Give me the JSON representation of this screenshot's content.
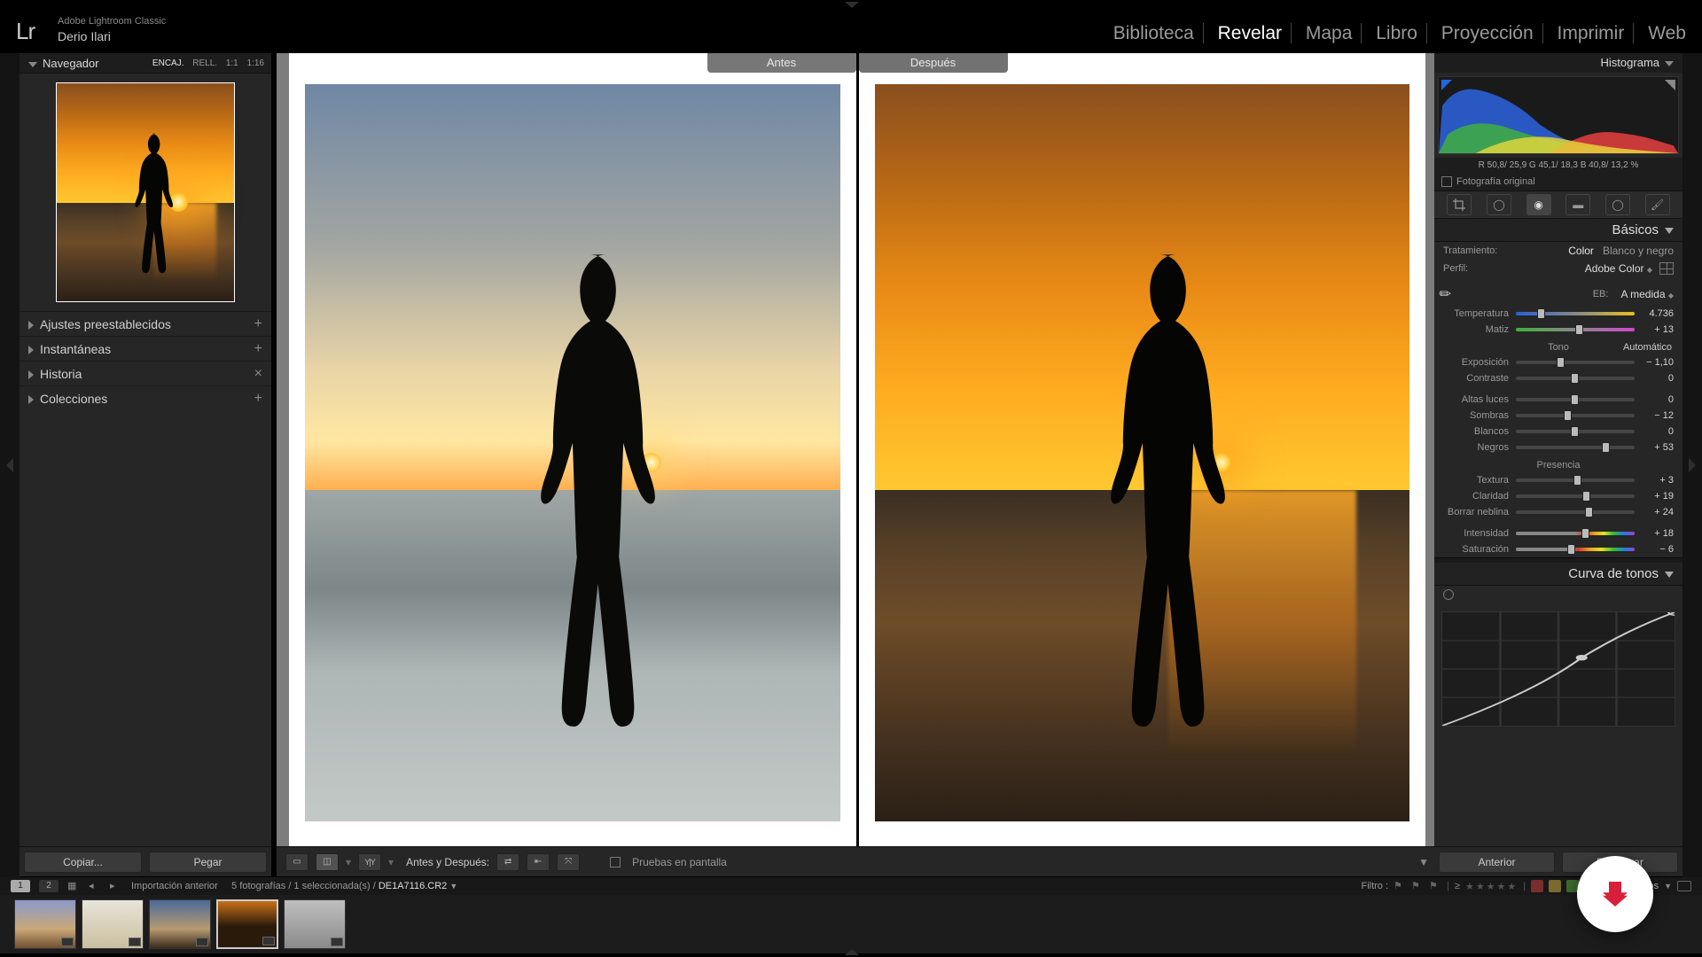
{
  "app": {
    "title": "Adobe Lightroom Classic",
    "logo": "Lr",
    "user": "Derio Ilari"
  },
  "nav": {
    "items": [
      "Biblioteca",
      "Revelar",
      "Mapa",
      "Libro",
      "Proyección",
      "Imprimir",
      "Web"
    ],
    "active": "Revelar"
  },
  "left": {
    "navigator": "Navegador",
    "zoom": {
      "fit": "ENCAJ.",
      "fill": "RELL.",
      "one": "1:1",
      "ratio": "1:16"
    },
    "rows": [
      {
        "label": "Ajustes preestablecidos",
        "icon": "+"
      },
      {
        "label": "Instantáneas",
        "icon": "+"
      },
      {
        "label": "Historia",
        "icon": "×"
      },
      {
        "label": "Colecciones",
        "icon": "+"
      }
    ],
    "copy": "Copiar...",
    "paste": "Pegar"
  },
  "compare": {
    "before": "Antes",
    "after": "Después"
  },
  "center_tools": {
    "mode": "Antes y Después:",
    "softproof": "Pruebas en pantalla"
  },
  "right": {
    "histogram": "Histograma",
    "rgb": "R  50,8/  25,9    G  45,1/  18,3    B  40,8/  13,2  %",
    "original": "Fotografía original",
    "basics": "Básicos",
    "treatment": {
      "label": "Tratamiento:",
      "color": "Color",
      "bw": "Blanco y negro"
    },
    "profile": {
      "label": "Perfil:",
      "value": "Adobe Color"
    },
    "wb": {
      "label": "EB:",
      "value": "A medida"
    },
    "sliders": {
      "temp": {
        "label": "Temperatura",
        "value": "4.736"
      },
      "tint": {
        "label": "Matiz",
        "value": "+ 13"
      },
      "tone_head": "Tono",
      "auto": "Automático",
      "expo": {
        "label": "Exposición",
        "value": "− 1,10"
      },
      "contrast": {
        "label": "Contraste",
        "value": "0"
      },
      "high": {
        "label": "Altas luces",
        "value": "0"
      },
      "shad": {
        "label": "Sombras",
        "value": "− 12"
      },
      "white": {
        "label": "Blancos",
        "value": "0"
      },
      "black": {
        "label": "Negros",
        "value": "+ 53"
      },
      "presence": "Presencia",
      "tex": {
        "label": "Textura",
        "value": "+ 3"
      },
      "clar": {
        "label": "Claridad",
        "value": "+ 19"
      },
      "dehaze": {
        "label": "Borrar neblina",
        "value": "+ 24"
      },
      "vib": {
        "label": "Intensidad",
        "value": "+ 18"
      },
      "sat": {
        "label": "Saturación",
        "value": "− 6"
      }
    },
    "tone_curve": "Curva de tonos",
    "prev": "Anterior",
    "reset": "Restaurar"
  },
  "info": {
    "source": "Importación anterior",
    "count": "5 fotografías / 1 seleccionada(s) / ",
    "file": "DE1A7116.CR2",
    "filter_label": "Filtro :",
    "filters_word": "Filtros"
  }
}
